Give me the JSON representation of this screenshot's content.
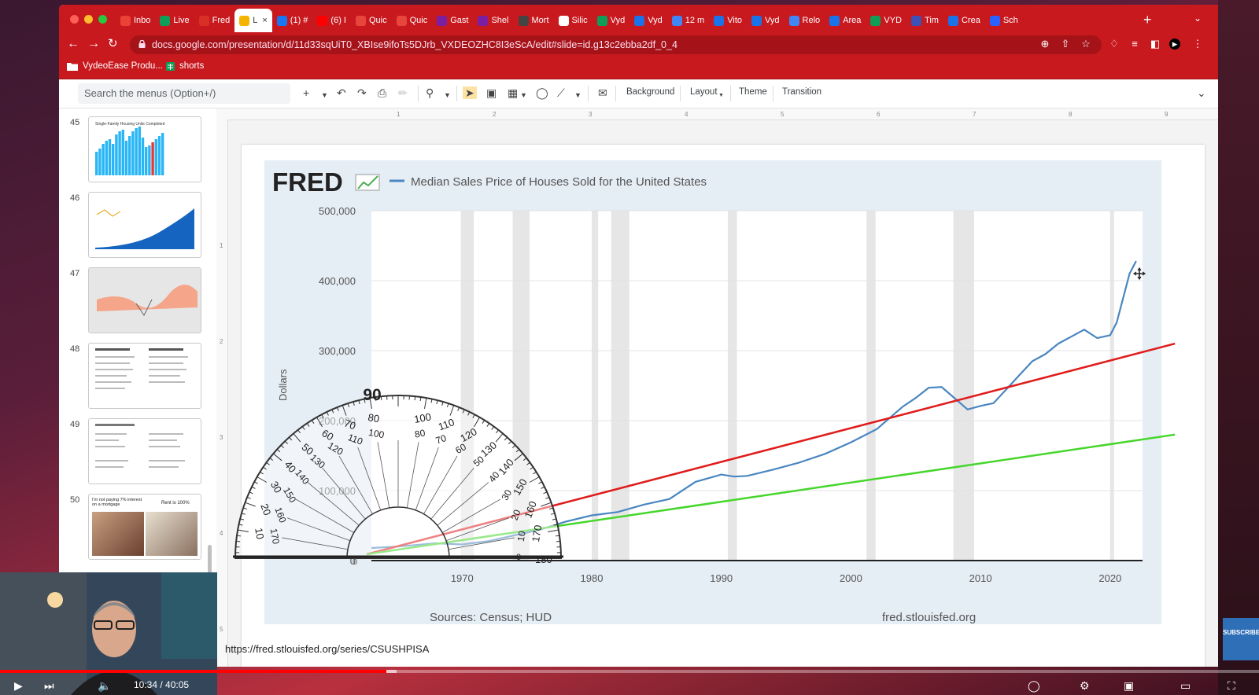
{
  "browser": {
    "tabs": [
      {
        "label": "Inbo",
        "color": "#ea4335"
      },
      {
        "label": "Live",
        "color": "#0f9d58"
      },
      {
        "label": "Fred",
        "color": "#d93025"
      },
      {
        "label": "L",
        "color": "#f4b400",
        "active": true
      },
      {
        "label": "(1) #",
        "color": "#1877f2"
      },
      {
        "label": "(6) I",
        "color": "#ff0000"
      },
      {
        "label": "Quic",
        "color": "#e8453c"
      },
      {
        "label": "Quic",
        "color": "#e8453c"
      },
      {
        "label": "Gast",
        "color": "#7b1fa2"
      },
      {
        "label": "Shel",
        "color": "#7b1fa2"
      },
      {
        "label": "Mort",
        "color": "#444444"
      },
      {
        "label": "Silic",
        "color": "#ffffff"
      },
      {
        "label": "Vyd",
        "color": "#0f9d58"
      },
      {
        "label": "Vyd",
        "color": "#1a73e8"
      },
      {
        "label": "12 m",
        "color": "#4285f4"
      },
      {
        "label": "Vito",
        "color": "#1a73e8"
      },
      {
        "label": "Vyd",
        "color": "#1a73e8"
      },
      {
        "label": "Relo",
        "color": "#4285f4"
      },
      {
        "label": "Area",
        "color": "#1a73e8"
      },
      {
        "label": "VYD",
        "color": "#0f9d58"
      },
      {
        "label": "Tim",
        "color": "#3f51b5"
      },
      {
        "label": "Crea",
        "color": "#1a73e8"
      },
      {
        "label": "Sch",
        "color": "#2962ff"
      }
    ],
    "new_tab": "+",
    "url": "docs.google.com/presentation/d/11d33sqUiT0_XBIse9ifoTs5DJrb_VXDEOZHC8I3eScA/edit#slide=id.g13c2ebba2df_0_4",
    "bookmarks": [
      "VydeoEase Produ...",
      "shorts"
    ]
  },
  "slides_toolbar": {
    "search_placeholder": "Search the menus (Option+/)",
    "background": "Background",
    "layout": "Layout",
    "theme": "Theme",
    "transition": "Transition"
  },
  "ruler_marks": [
    "1",
    "2",
    "3",
    "4",
    "5",
    "6",
    "7",
    "8",
    "9"
  ],
  "filmstrip": {
    "slides": [
      {
        "num": "45",
        "title": "Single-Family Housing Units Completed"
      },
      {
        "num": "46",
        "title": "Chart"
      },
      {
        "num": "47",
        "title": "Map"
      },
      {
        "num": "48",
        "title": "Why the market WON'T crash / Why the market WILL crash"
      },
      {
        "num": "49",
        "title": "Text"
      },
      {
        "num": "50",
        "caption_left": "I'm not paying 7% interest on a mortgage",
        "caption_right": "Rent is 100%"
      }
    ]
  },
  "fred": {
    "logo": "FRED",
    "series_label": "Median Sales Price of Houses Sold for the United States",
    "ylabel": "Dollars",
    "sources": "Sources: Census; HUD",
    "site": "fred.stlouisfed.org",
    "overlay_colors": {
      "red_line": "#e01b1b",
      "green_line": "#46d62b",
      "series": "#4a86c0"
    }
  },
  "chart_data": {
    "type": "line",
    "title": "Median Sales Price of Houses Sold for the United States",
    "xlabel": "",
    "ylabel": "Dollars",
    "ylim": [
      0,
      500000
    ],
    "xlim": [
      1963,
      2022.5
    ],
    "x_ticks": [
      1970,
      1980,
      1990,
      2000,
      2010,
      2020
    ],
    "y_ticks": [
      "0",
      "100,000",
      "200,000",
      "300,000",
      "400,000",
      "500,000"
    ],
    "recessions": [
      [
        1969.9,
        1970.9
      ],
      [
        1973.9,
        1975.2
      ],
      [
        1980.0,
        1980.5
      ],
      [
        1981.5,
        1982.9
      ],
      [
        1990.5,
        1991.2
      ],
      [
        2001.2,
        2001.9
      ],
      [
        2007.9,
        2009.5
      ],
      [
        2020.0,
        2020.3
      ]
    ],
    "series": [
      {
        "name": "Median Sales Price of Houses Sold for the United States",
        "x": [
          1963,
          1965,
          1968,
          1970,
          1972,
          1974,
          1976,
          1978,
          1980,
          1982,
          1984,
          1986,
          1988,
          1990,
          1991,
          1992,
          1994,
          1996,
          1998,
          2000,
          2002,
          2004,
          2005,
          2006,
          2007,
          2008,
          2009,
          2010,
          2011,
          2012,
          2013,
          2014,
          2015,
          2016,
          2017,
          2018,
          2019,
          2020,
          2020.5,
          2021,
          2021.5,
          2022
        ],
        "values": [
          18000,
          20000,
          24700,
          23000,
          27600,
          35900,
          44200,
          55700,
          64600,
          69300,
          79900,
          88000,
          112500,
          122900,
          120000,
          121000,
          130000,
          140000,
          152500,
          169000,
          188000,
          220000,
          232500,
          247000,
          248000,
          232000,
          216000,
          221000,
          225000,
          245000,
          265000,
          285000,
          295000,
          310000,
          320000,
          330000,
          318000,
          322000,
          340000,
          375000,
          410000,
          428000
        ]
      }
    ],
    "annotations": [
      {
        "type": "line",
        "color": "#e01b1b",
        "from": [
          1963,
          0
        ],
        "to": [
          2025,
          310000
        ]
      },
      {
        "type": "line",
        "color": "#46d62b",
        "from": [
          1963,
          0
        ],
        "to": [
          2025,
          180000
        ]
      },
      {
        "type": "protractor",
        "label": "90"
      }
    ]
  },
  "protractor": {
    "top_label": "90",
    "outer_numbers": [
      "10",
      "20",
      "30",
      "40",
      "50",
      "60",
      "70",
      "80",
      "100",
      "110",
      "120",
      "130",
      "140",
      "150",
      "160",
      "170"
    ],
    "inner_numbers": [
      "170",
      "160",
      "150",
      "140",
      "130",
      "120",
      "110",
      "100",
      "80",
      "70",
      "60",
      "50",
      "40",
      "30",
      "20",
      "10"
    ],
    "end_labels": [
      "0",
      "180",
      "0"
    ]
  },
  "source_url": "https://fred.stlouisfed.org/series/CSUSHPISA",
  "player": {
    "time": "10:34 / 40:05",
    "progress": 0.307,
    "buffered": 0.315,
    "subscribe": "SUBSCRIBE"
  }
}
